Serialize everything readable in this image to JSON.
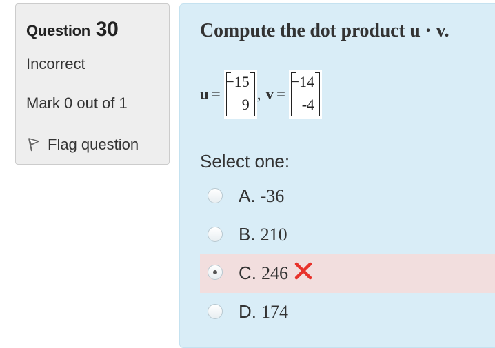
{
  "info": {
    "question_label": "Question",
    "question_number": "30",
    "state": "Incorrect",
    "grade": "Mark 0 out of 1",
    "flag_label": "Flag question",
    "flag_icon": "flag-icon"
  },
  "question": {
    "text": "Compute the dot product u · v.",
    "u_label": "u",
    "v_label": "v",
    "equals": "=",
    "comma": ",",
    "u_entries": [
      "−15",
      "9"
    ],
    "v_entries": [
      "−14",
      "-4"
    ]
  },
  "answer": {
    "prompt": "Select one:",
    "options": [
      {
        "letter": "A.",
        "value": "-36",
        "selected": false
      },
      {
        "letter": "B.",
        "value": "210",
        "selected": false
      },
      {
        "letter": "C.",
        "value": "246",
        "selected": true,
        "marked_incorrect": true
      },
      {
        "letter": "D.",
        "value": "174",
        "selected": false
      }
    ],
    "incorrect_icon": "cross-icon"
  },
  "colors": {
    "info_bg": "#eeeeee",
    "content_bg": "#d9edf7",
    "incorrect_bg": "#f2dede",
    "cross": "#e8322b"
  }
}
